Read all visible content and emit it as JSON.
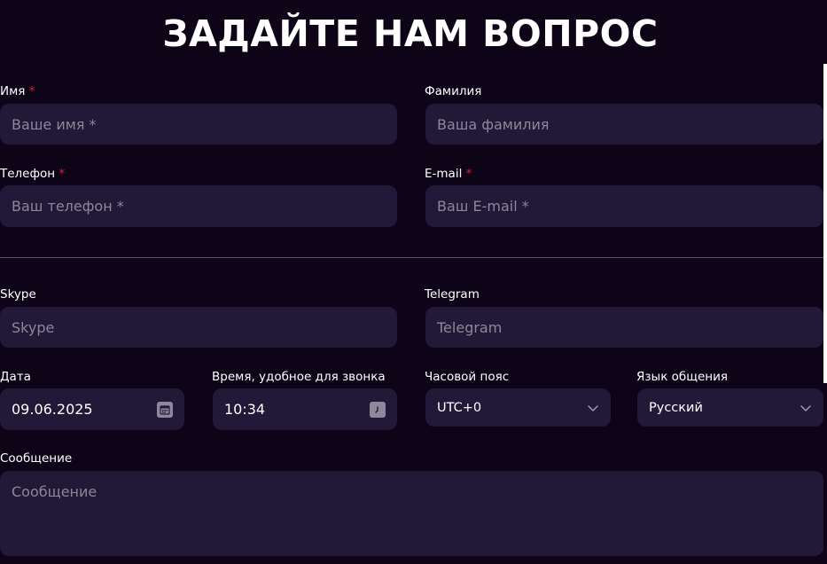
{
  "form": {
    "title": "ЗАДАЙТЕ НАМ ВОПРОС",
    "required_mark": "*",
    "first_name": {
      "label": "Имя",
      "required": true,
      "placeholder": "Ваше имя *"
    },
    "last_name": {
      "label": "Фамилия",
      "required": false,
      "placeholder": "Ваша фамилия"
    },
    "phone": {
      "label": "Телефон",
      "required": true,
      "placeholder": "Ваш телефон *"
    },
    "email": {
      "label": "E-mail",
      "required": true,
      "placeholder": "Ваш E-mail *"
    },
    "skype": {
      "label": "Skype",
      "placeholder": "Skype"
    },
    "telegram": {
      "label": "Telegram",
      "placeholder": "Telegram"
    },
    "date": {
      "label": "Дата",
      "value": "09.06.2025",
      "icon": "calendar-icon"
    },
    "time": {
      "label": "Время, удобное для звонка",
      "value": "10:34",
      "icon": "clock-icon"
    },
    "timezone": {
      "label": "Часовой пояс",
      "value": "UTC+0",
      "icon": "chevron-down-icon"
    },
    "language": {
      "label": "Язык общения",
      "value": "Русский",
      "icon": "chevron-down-icon"
    },
    "message": {
      "label": "Сообщение",
      "placeholder": "Сообщение"
    }
  },
  "colors": {
    "background": "#0d0418",
    "field_background": "#221838",
    "placeholder": "#8d8799",
    "required": "#e11d3a",
    "divider": "#58516a"
  }
}
